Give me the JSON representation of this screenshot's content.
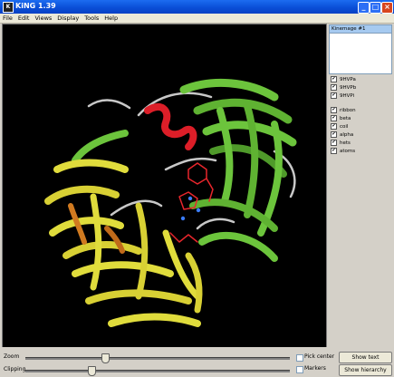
{
  "window": {
    "title": "KiNG 1.39",
    "icon": "king-app-icon"
  },
  "menu": [
    "File",
    "Edit",
    "Views",
    "Display",
    "Tools",
    "Help"
  ],
  "kinemage": {
    "selected": "Kinemage #1"
  },
  "groups": [
    {
      "label": "9HVPa",
      "checked": true
    },
    {
      "label": "9HVPb",
      "checked": true
    },
    {
      "label": "9HVPi",
      "checked": true
    }
  ],
  "masters": [
    {
      "label": "ribbon",
      "checked": true
    },
    {
      "label": "beta",
      "checked": true
    },
    {
      "label": "coil",
      "checked": true
    },
    {
      "label": "alpha",
      "checked": true
    },
    {
      "label": "hets",
      "checked": true
    },
    {
      "label": "atoms",
      "checked": true
    }
  ],
  "controls": {
    "zoom_label": "Zoom",
    "clipping_label": "Clipping",
    "zoom_value": 0.3,
    "clipping_value": 0.25,
    "pick_center": "Pick center",
    "markers": "Markers",
    "show_text": "Show text",
    "show_hierarchy": "Show hierarchy"
  },
  "colors": {
    "beta_chain_a": "#6cc43c",
    "beta_chain_b": "#e0dc3c",
    "alpha": "#dc1e28",
    "coil": "#c8c8c8",
    "hets": "#e8262c",
    "background": "#000000"
  }
}
